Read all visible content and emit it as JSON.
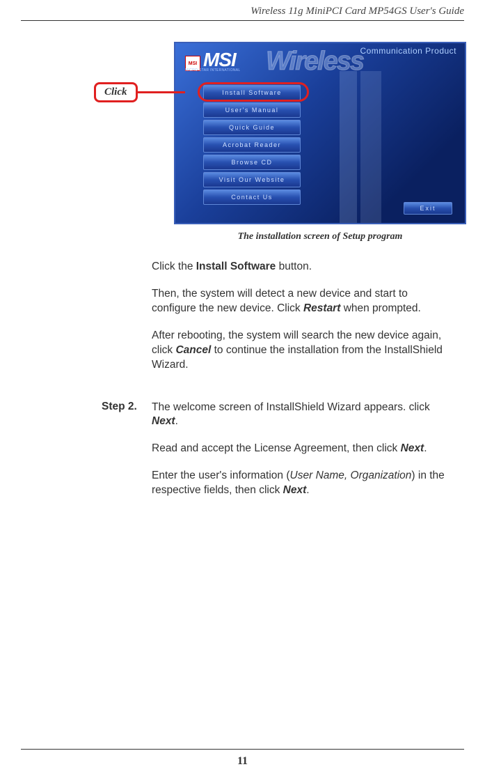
{
  "header": {
    "title": "Wireless 11g MiniPCI Card MP54GS User's Guide"
  },
  "callout": {
    "label": "Click"
  },
  "installer": {
    "logo_small": "MSI",
    "brand": "MSI",
    "brand_sub": "MICRO-STAR INTERNATIONAL",
    "bg_word": "Wireless",
    "comm_product": "Communication Product",
    "buttons": [
      "Install Software",
      "User's Manual",
      "Quick Guide",
      "Acrobat Reader",
      "Browse  CD",
      "Visit Our Website",
      "Contact Us"
    ],
    "exit": "Exit"
  },
  "caption": "The installation screen of Setup program",
  "paragraphs": {
    "p1_a": "Click the ",
    "p1_b": "Install Software",
    "p1_c": " button.",
    "p2_a": "Then, the system will detect a new device and start to configure the new device.  Click ",
    "p2_b": "Restart",
    "p2_c": " when prompted.",
    "p3_a": "After rebooting, the system will search the new device again, click ",
    "p3_b": "Cancel",
    "p3_c": " to continue the installation from the InstallShield Wizard."
  },
  "step2": {
    "label": "Step 2.",
    "p1_a": "The welcome screen of InstallShield Wizard appears. click ",
    "p1_b": "Next",
    "p1_c": ".",
    "p2_a": "Read and accept the License Agreement, then click ",
    "p2_b": "Next",
    "p2_c": ".",
    "p3_a": "Enter the user's information (",
    "p3_b": "User Name, Organization",
    "p3_c": ") in the respective fields, then click ",
    "p3_d": "Next",
    "p3_e": "."
  },
  "page_number": "11"
}
